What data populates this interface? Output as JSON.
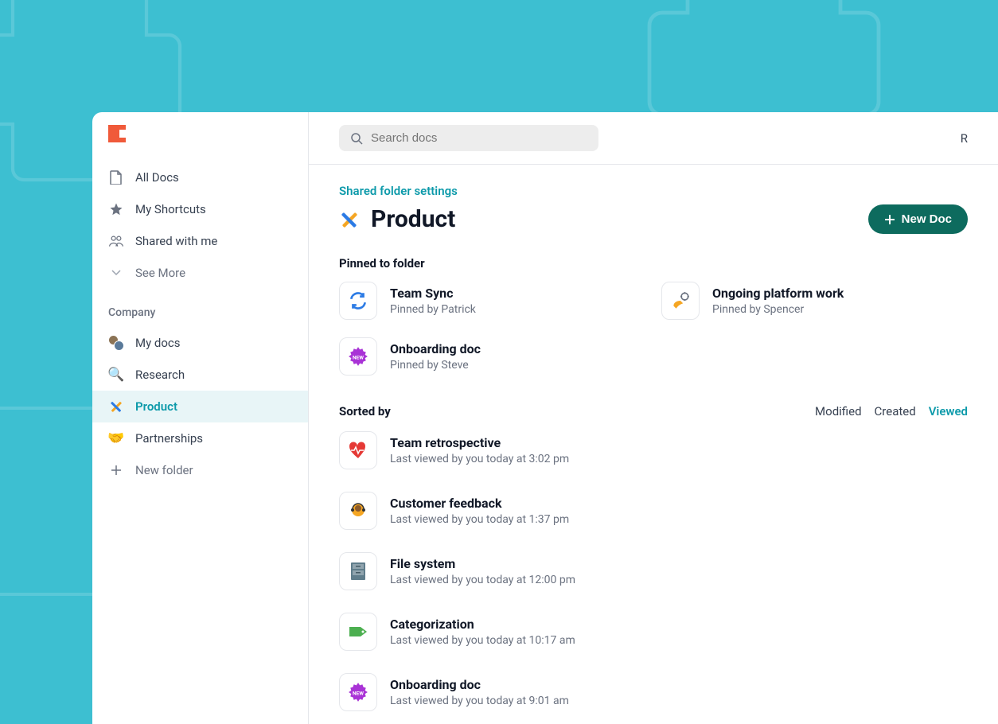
{
  "search": {
    "placeholder": "Search docs"
  },
  "topbar": {
    "right_truncated": "R"
  },
  "sidebar": {
    "nav": [
      {
        "label": "All Docs"
      },
      {
        "label": "My Shortcuts"
      },
      {
        "label": "Shared with me"
      },
      {
        "label": "See More"
      }
    ],
    "section_label": "Company",
    "company": [
      {
        "label": "My docs"
      },
      {
        "label": "Research"
      },
      {
        "label": "Product"
      },
      {
        "label": "Partnerships"
      },
      {
        "label": "New folder"
      }
    ]
  },
  "page": {
    "settings_link": "Shared folder settings",
    "title": "Product",
    "new_doc_label": "New Doc",
    "pinned_header": "Pinned to folder",
    "pinned": [
      {
        "title": "Team Sync",
        "sub": "Pinned by Patrick"
      },
      {
        "title": "Ongoing platform work",
        "sub": "Pinned by Spencer"
      },
      {
        "title": "Onboarding doc",
        "sub": "Pinned by Steve"
      }
    ],
    "sorted_header": "Sorted by",
    "sort_options": [
      "Modified",
      "Created",
      "Viewed"
    ],
    "sort_active": "Viewed",
    "docs": [
      {
        "title": "Team retrospective",
        "sub": "Last viewed by you today at 3:02 pm"
      },
      {
        "title": "Customer feedback",
        "sub": "Last viewed by you today at 1:37 pm"
      },
      {
        "title": "File system",
        "sub": "Last viewed by you today at 12:00 pm"
      },
      {
        "title": "Categorization",
        "sub": "Last viewed by you today at 10:17 am"
      },
      {
        "title": "Onboarding doc",
        "sub": "Last viewed by you today at 9:01 am"
      }
    ]
  }
}
